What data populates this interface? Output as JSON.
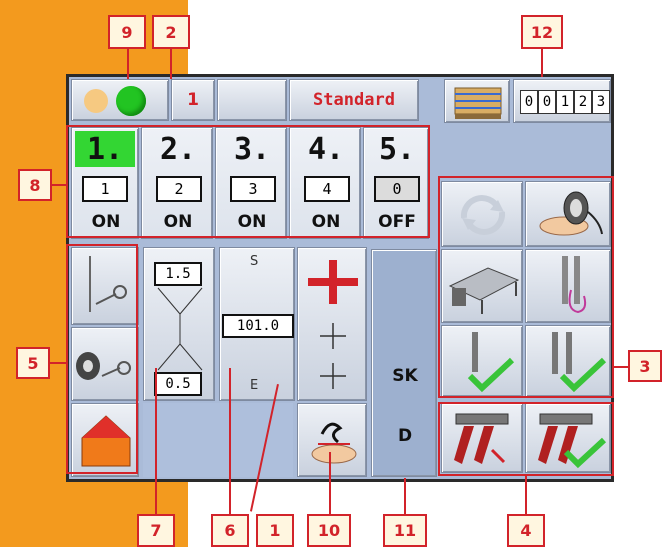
{
  "callouts": [
    "9",
    "2",
    "12",
    "8",
    "5",
    "3",
    "7",
    "6",
    "1",
    "10",
    "11",
    "4"
  ],
  "topbar": {
    "counter_value": "1",
    "mode_label": "Standard",
    "counter_digits": [
      "0",
      "0",
      "1",
      "2",
      "3"
    ]
  },
  "steps": [
    {
      "index": "1.",
      "value": "1",
      "state": "ON"
    },
    {
      "index": "2.",
      "value": "2",
      "state": "ON"
    },
    {
      "index": "3.",
      "value": "3",
      "state": "ON"
    },
    {
      "index": "4.",
      "value": "4",
      "state": "ON"
    },
    {
      "index": "5.",
      "value": "0",
      "state": "OFF"
    }
  ],
  "stitch": {
    "top_value": "1.5",
    "bottom_value": "0.5",
    "length_value": "101.0",
    "start_letter": "S",
    "end_letter": "E"
  },
  "side_panel": {
    "line1": "SK",
    "line2": "D"
  },
  "colors": {
    "accent_red": "#d2232a",
    "orange": "#f39a1e",
    "screen_bg": "#aabbd8",
    "active_green": "#2fd12f"
  }
}
